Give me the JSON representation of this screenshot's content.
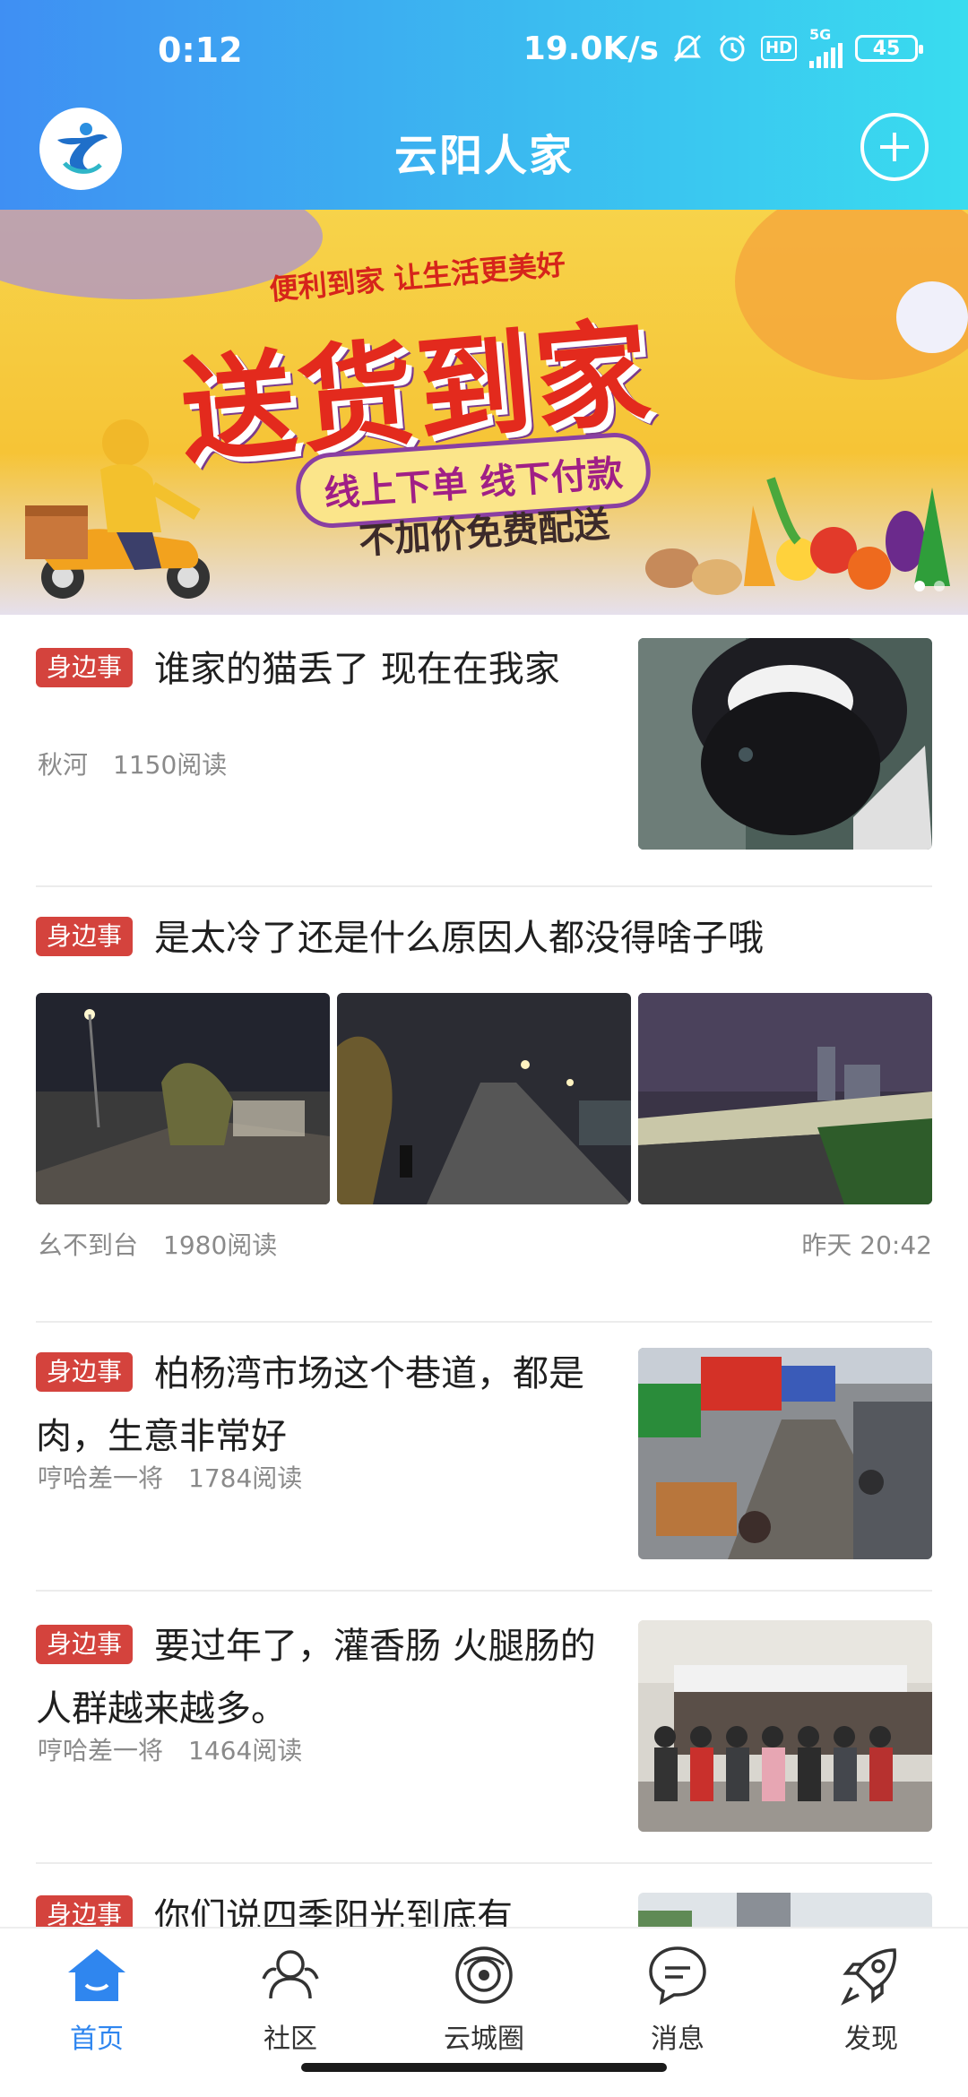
{
  "status_bar": {
    "time": "0:12",
    "network_speed": "19.0K/s",
    "hd_label": "HD",
    "network_type": "5G",
    "battery": "45"
  },
  "app_bar": {
    "title": "云阳人家"
  },
  "banner": {
    "tagline": "便利到家 让生活更美好",
    "headline": "送货到家",
    "pill": "线上下单 线下付款",
    "sub": "不加价免费配送"
  },
  "feed": [
    {
      "tag": "身边事",
      "title": "谁家的猫丢了 现在在我家",
      "author": "秋河",
      "reads": "1150阅读"
    },
    {
      "tag": "身边事",
      "title": "是太冷了还是什么原因人都没得啥子哦",
      "author": "幺不到台",
      "reads": "1980阅读",
      "time": "昨天 20:42"
    },
    {
      "tag": "身边事",
      "title": "柏杨湾市场这个巷道，都是肉，生意非常好",
      "author": "哼哈差一将",
      "reads": "1784阅读"
    },
    {
      "tag": "身边事",
      "title": "要过年了，灌香肠 火腿肠的人群越来越多。",
      "author": "哼哈差一将",
      "reads": "1464阅读"
    },
    {
      "tag": "身边事",
      "title": "你们说四季阳光到底有"
    }
  ],
  "bottom_nav": {
    "items": [
      {
        "label": "首页",
        "icon": "home-icon"
      },
      {
        "label": "社区",
        "icon": "community-icon"
      },
      {
        "label": "云城圈",
        "icon": "circle-icon"
      },
      {
        "label": "消息",
        "icon": "message-icon"
      },
      {
        "label": "发现",
        "icon": "rocket-icon"
      }
    ]
  },
  "colors": {
    "accent": "#2f86ef",
    "tag": "#d4433d",
    "header_start": "#3f8ff3",
    "header_end": "#39dcef"
  }
}
